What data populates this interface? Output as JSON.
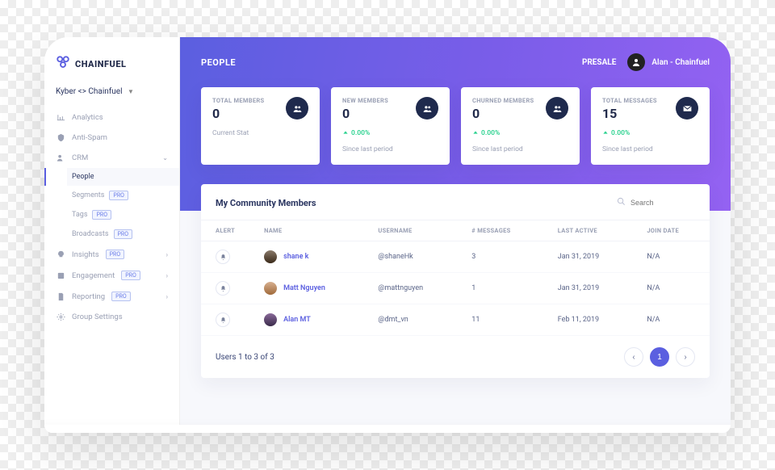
{
  "brand": {
    "name": "CHAINFUEL"
  },
  "workspace": {
    "name": "Kyber <> Chainfuel"
  },
  "nav": {
    "analytics": "Analytics",
    "antispam": "Anti-Spam",
    "crm": "CRM",
    "people": "People",
    "segments": "Segments",
    "tags": "Tags",
    "broadcasts": "Broadcasts",
    "insights": "Insights",
    "engagement": "Engagement",
    "reporting": "Reporting",
    "group_settings": "Group Settings",
    "pro": "PRO"
  },
  "topbar": {
    "title": "PEOPLE",
    "presale": "PRESALE",
    "user": "Alan - Chainfuel"
  },
  "stats": {
    "total_members": {
      "label": "TOTAL MEMBERS",
      "value": "0",
      "sub": "Current Stat"
    },
    "new_members": {
      "label": "NEW MEMBERS",
      "value": "0",
      "trend": "0.00%",
      "sub": "Since last period"
    },
    "churned": {
      "label": "CHURNED MEMBERS",
      "value": "0",
      "trend": "0.00%",
      "sub": "Since last period"
    },
    "messages": {
      "label": "TOTAL MESSAGES",
      "value": "15",
      "trend": "0.00%",
      "sub": "Since last period"
    }
  },
  "panel": {
    "title": "My Community Members",
    "search_placeholder": "Search",
    "columns": {
      "alert": "ALERT",
      "name": "NAME",
      "username": "USERNAME",
      "messages": "# MESSAGES",
      "last_active": "LAST ACTIVE",
      "join_date": "JOIN DATE"
    },
    "rows": [
      {
        "name": "shane k",
        "username": "@shaneHk",
        "messages": "3",
        "last_active": "Jan 31, 2019",
        "join_date": "N/A"
      },
      {
        "name": "Matt Nguyen",
        "username": "@mattnguyen",
        "messages": "1",
        "last_active": "Jan 31, 2019",
        "join_date": "N/A"
      },
      {
        "name": "Alan MT",
        "username": "@dmt_vn",
        "messages": "11",
        "last_active": "Feb 11, 2019",
        "join_date": "N/A"
      }
    ],
    "footer": "Users 1 to 3 of 3",
    "page": "1"
  }
}
